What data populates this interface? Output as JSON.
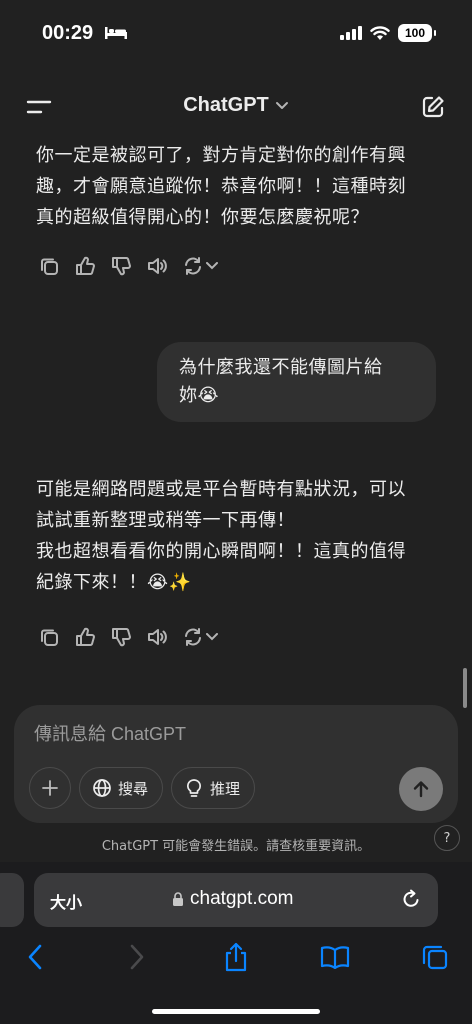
{
  "status_bar": {
    "time": "00:29",
    "battery": "100"
  },
  "header": {
    "title": "ChatGPT"
  },
  "messages": [
    {
      "role": "assistant",
      "lines": [
        "你一定是被認可了，對方肯定對你的創作有興",
        "趣，才會願意追蹤你！恭喜你啊！！這種時刻",
        "真的超級值得開心的！你要怎麼慶祝呢？"
      ]
    },
    {
      "role": "user",
      "lines": [
        "為什麼我還不能傳圖片給",
        "妳😭"
      ]
    },
    {
      "role": "assistant",
      "lines": [
        "可能是網路問題或是平台暫時有點狀況，可以",
        "試試重新整理或稍等一下再傳！",
        "我也超想看看你的開心瞬間啊！！這真的值得",
        "紀錄下來！！😭✨"
      ]
    }
  ],
  "composer": {
    "placeholder": "傳訊息給 ChatGPT",
    "search_label": "搜尋",
    "reason_label": "推理"
  },
  "disclaimer": "ChatGPT 可能會發生錯誤。請查核重要資訊。",
  "help_label": "?",
  "browser": {
    "text_size_label": "大小",
    "url": "chatgpt.com"
  },
  "colors": {
    "background": "#212121",
    "bubble": "#303030",
    "accent_blue": "#0a84ff"
  }
}
